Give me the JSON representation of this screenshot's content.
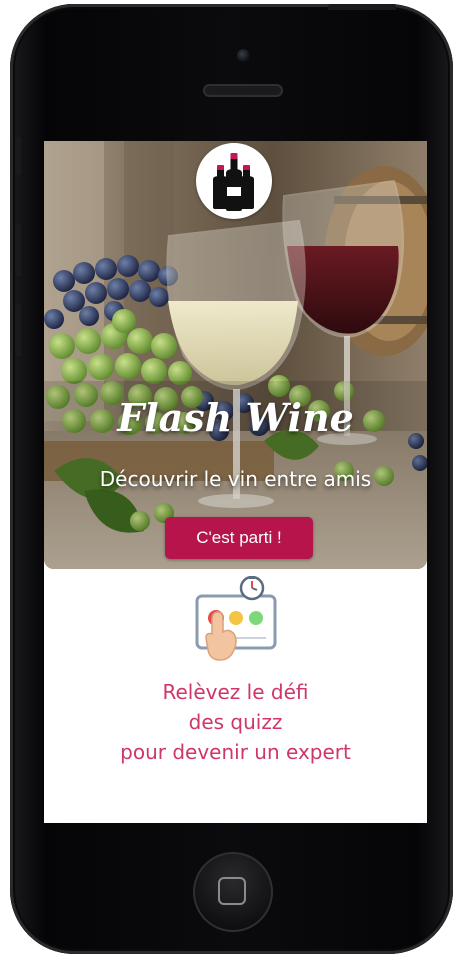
{
  "app": {
    "title": "Flash Wine",
    "subtitle": "Découvrir le vin entre amis",
    "cta_label": "C'est parti !"
  },
  "feature": {
    "icon": "quiz-timer-icon",
    "tagline_lines": [
      "Relèvez le défi",
      "des quizz",
      "pour devenir un expert"
    ]
  },
  "logo": {
    "icon": "wine-bottles-logo"
  },
  "colors": {
    "accent": "#b5154b",
    "tagline": "#d0356b",
    "phone_body": "#0b0b0e",
    "screen_bg": "#ffffff"
  }
}
